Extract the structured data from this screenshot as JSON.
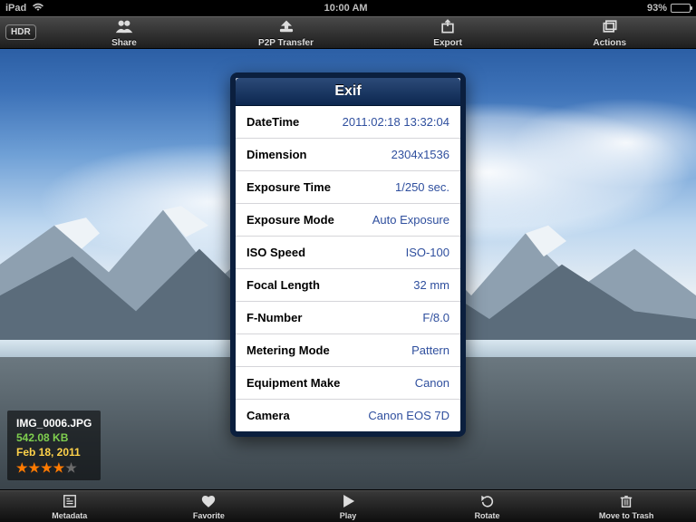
{
  "status": {
    "device": "iPad",
    "time": "10:00 AM",
    "battery_pct": "93%",
    "battery_fill": 93
  },
  "toolbar": {
    "hdr_label": "HDR",
    "items": [
      {
        "id": "share",
        "label": "Share"
      },
      {
        "id": "p2p",
        "label": "P2P Transfer"
      },
      {
        "id": "export",
        "label": "Export"
      },
      {
        "id": "actions",
        "label": "Actions"
      }
    ]
  },
  "fileinfo": {
    "name": "IMG_0006.JPG",
    "size": "542.08 KB",
    "date": "Feb 18, 2011",
    "rating": 4,
    "rating_max": 5
  },
  "popover": {
    "title": "Exif",
    "rows": [
      {
        "label": "DateTime",
        "value": "2011:02:18 13:32:04"
      },
      {
        "label": "Dimension",
        "value": "2304x1536"
      },
      {
        "label": "Exposure Time",
        "value": "1/250 sec."
      },
      {
        "label": "Exposure Mode",
        "value": "Auto Exposure"
      },
      {
        "label": "ISO Speed",
        "value": "ISO-100"
      },
      {
        "label": "Focal Length",
        "value": "32 mm"
      },
      {
        "label": "F-Number",
        "value": "F/8.0"
      },
      {
        "label": "Metering Mode",
        "value": "Pattern"
      },
      {
        "label": "Equipment Make",
        "value": "Canon"
      },
      {
        "label": "Camera",
        "value": "Canon EOS 7D"
      }
    ]
  },
  "bottombar": {
    "items": [
      {
        "id": "metadata",
        "label": "Metadata"
      },
      {
        "id": "favorite",
        "label": "Favorite"
      },
      {
        "id": "play",
        "label": "Play"
      },
      {
        "id": "rotate",
        "label": "Rotate"
      },
      {
        "id": "trash",
        "label": "Move to Trash"
      }
    ]
  }
}
